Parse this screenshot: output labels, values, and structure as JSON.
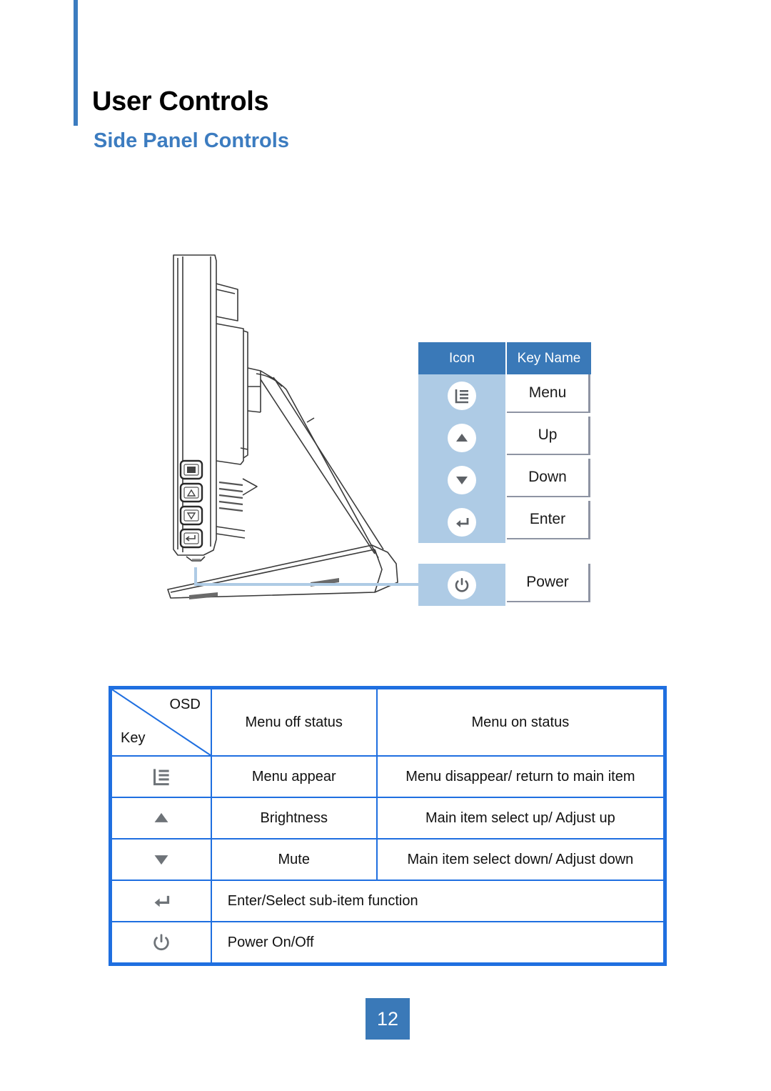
{
  "header": {
    "title": "User Controls",
    "subtitle": "Side Panel Controls",
    "accent_color": "#3c7cc0"
  },
  "illustration": {
    "name": "monitor-side-view-line-drawing",
    "description": "Side view line art of a monitor on a slanted stand with four side-panel buttons",
    "side_buttons": [
      "menu",
      "up",
      "down",
      "enter"
    ]
  },
  "key_table": {
    "headers": {
      "icon": "Icon",
      "key_name": "Key Name"
    },
    "header_bg": "#3a79b8",
    "icon_column_bg": "#aecbe5",
    "rows": [
      {
        "icon": "menu-icon",
        "name": "Menu"
      },
      {
        "icon": "up-arrow-icon",
        "name": "Up"
      },
      {
        "icon": "down-arrow-icon",
        "name": "Down"
      },
      {
        "icon": "enter-icon",
        "name": "Enter"
      }
    ],
    "power_row": {
      "icon": "power-icon",
      "name": "Power"
    }
  },
  "osd_table": {
    "border_color": "#1f6fe0",
    "corner": {
      "top_label": "OSD",
      "bottom_label": "Key"
    },
    "column_headers": {
      "menu_off": "Menu off status",
      "menu_on": "Menu on status"
    },
    "rows": [
      {
        "icon": "menu-icon",
        "menu_off": "Menu appear",
        "menu_on": "Menu disappear/ return to main item",
        "span": false
      },
      {
        "icon": "up-arrow-icon",
        "menu_off": "Brightness",
        "menu_on": "Main item select up/ Adjust up",
        "span": false
      },
      {
        "icon": "down-arrow-icon",
        "menu_off": "Mute",
        "menu_on": "Main item select down/ Adjust down",
        "span": false
      },
      {
        "icon": "enter-icon",
        "menu_off": "Enter/Select sub-item function",
        "menu_on": "",
        "span": true
      },
      {
        "icon": "power-icon",
        "menu_off": "Power On/Off",
        "menu_on": "",
        "span": true
      }
    ]
  },
  "footer": {
    "page_number": "12",
    "bg_color": "#3a79b8"
  }
}
